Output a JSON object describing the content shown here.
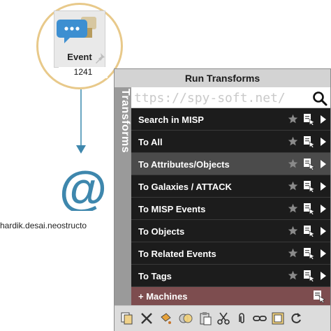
{
  "graph": {
    "event_node": {
      "label": "Event",
      "count": "1241"
    },
    "email_node": {
      "label": "hardik.desai.neostructo"
    }
  },
  "panel": {
    "title": "Run Transforms",
    "side_tab": "Transforms",
    "search": {
      "value": "ttps://spy-soft.net/"
    },
    "items": [
      {
        "label": "Search in MISP",
        "highlight": false
      },
      {
        "label": "To All",
        "highlight": false
      },
      {
        "label": "To Attributes/Objects",
        "highlight": true
      },
      {
        "label": "To Galaxies / ATTACK",
        "highlight": false
      },
      {
        "label": "To MISP Events",
        "highlight": false
      },
      {
        "label": "To Objects",
        "highlight": false
      },
      {
        "label": "To Related Events",
        "highlight": false
      },
      {
        "label": "To Tags",
        "highlight": false
      }
    ],
    "machines": {
      "label": "+  Machines"
    }
  },
  "colors": {
    "row_dark": "#1c1c1c",
    "row_highlight": "#4b4b4b",
    "machines_bar": "#7d4d4f",
    "side_tab": "#9a9a9a",
    "node_ring": "#e8c98a",
    "edge": "#6aa7c2",
    "at_icon": "#3e87ad"
  },
  "icons": {
    "row": [
      "star-icon",
      "transform-menu-icon",
      "run-arrow-icon"
    ],
    "toolbar": [
      "copy-icon",
      "delete-icon",
      "paint-icon",
      "merge-icon",
      "paste-icon",
      "cut-icon",
      "attach-icon",
      "link-icon",
      "select-icon",
      "refresh-icon"
    ]
  }
}
